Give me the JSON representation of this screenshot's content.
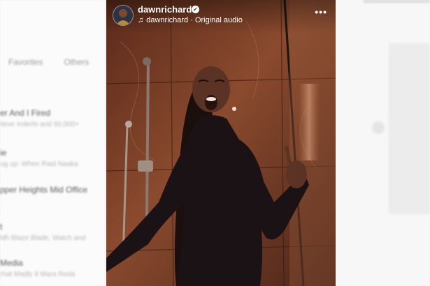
{
  "background_left": {
    "tabs": [
      "Favorites",
      "Others"
    ],
    "items": [
      {
        "title": "",
        "subtitle": ""
      },
      {
        "title": "er And I Fired",
        "subtitle": "iteve Inderlo and 60,000+"
      },
      {
        "title": "ie",
        "subtitle": "ug up: When Raid Naaka"
      },
      {
        "title": "pper Heights Mid Office",
        "subtitle": ""
      },
      {
        "title": "t",
        "subtitle": "ldh Blaze Blade, Watch and"
      },
      {
        "title": "Media",
        "subtitle": "rhat Madly 8 Mara Reda"
      }
    ]
  },
  "reel": {
    "username": "dawnrichard",
    "verified": "✔",
    "audio_label": "dawnrichard · Original audio",
    "icons": {
      "music": "music-note-icon",
      "more": "more-options-icon",
      "verified": "verified-badge-icon"
    }
  },
  "colors": {
    "tile": "#8a4a2e",
    "tile_dark": "#4a2418",
    "outfit": "#1a1215",
    "skin": "#5a3324"
  }
}
